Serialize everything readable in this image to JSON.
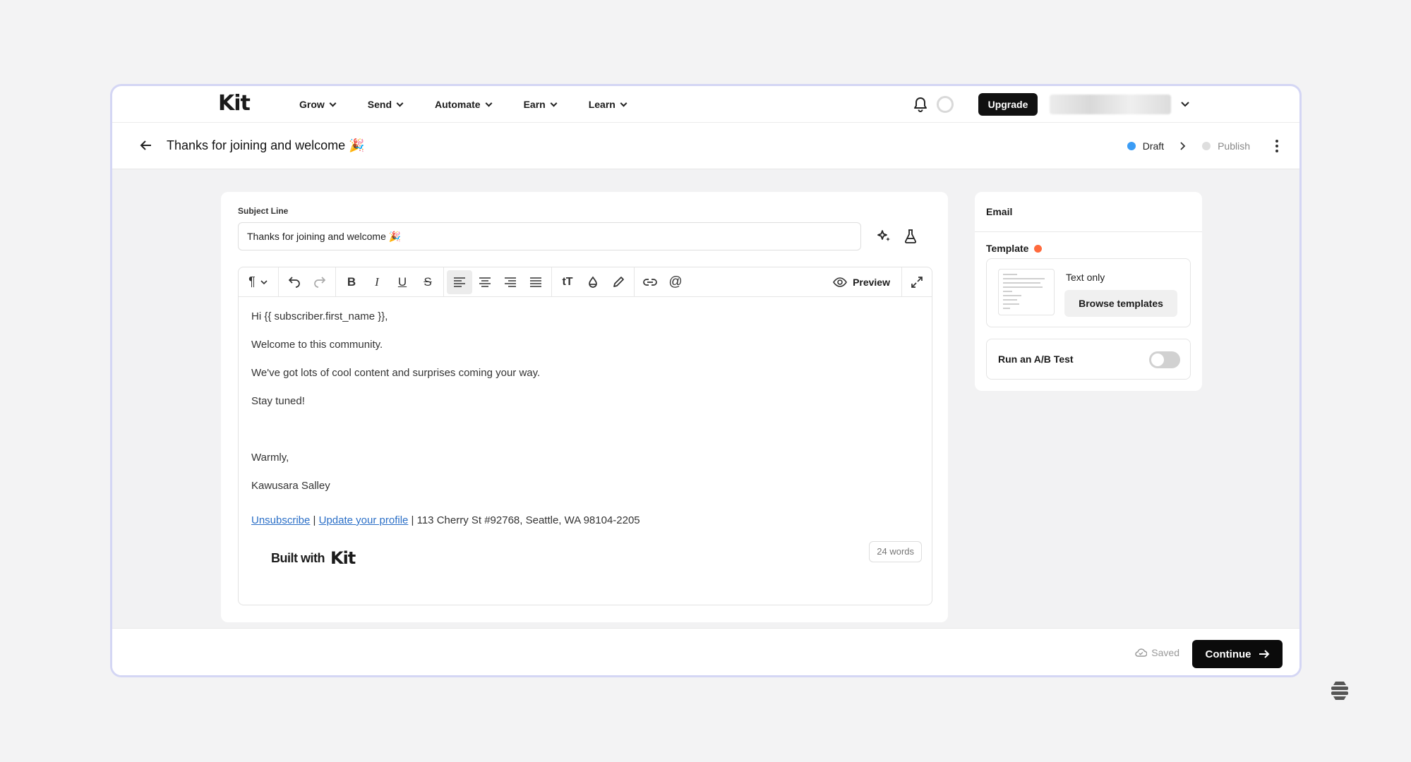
{
  "nav": {
    "logo": "Kit",
    "items": [
      {
        "label": "Grow"
      },
      {
        "label": "Send"
      },
      {
        "label": "Automate"
      },
      {
        "label": "Earn"
      },
      {
        "label": "Learn"
      }
    ],
    "upgrade_label": "Upgrade"
  },
  "header": {
    "title": "Thanks for joining and welcome 🎉",
    "steps": {
      "draft": "Draft",
      "publish": "Publish"
    }
  },
  "editor": {
    "subject_label": "Subject Line",
    "subject_value": "Thanks for joining and welcome 🎉",
    "preview_label": "Preview",
    "body": [
      "Hi {{ subscriber.first_name }},",
      "Welcome to this community.",
      "We've got lots of cool content and surprises coming your way.",
      "Stay tuned!",
      "",
      "Warmly,",
      "Kawusara Salley"
    ],
    "footer": {
      "unsubscribe": "Unsubscribe",
      "separator": "|",
      "update_profile": "Update your profile",
      "address": "| 113 Cherry St #92768, Seattle, WA 98104-2205"
    },
    "built_with": "Built with",
    "built_with_logo": "Kit",
    "word_count": "24 words"
  },
  "sidebar": {
    "title": "Email",
    "template_label": "Template",
    "template_name": "Text only",
    "browse_label": "Browse templates",
    "ab_label": "Run an A/B Test",
    "ab_enabled": false
  },
  "footer": {
    "saved_label": "Saved",
    "continue_label": "Continue"
  },
  "colors": {
    "accent": "#111111",
    "draft_dot": "#3b9cf5",
    "publish_dot": "#dedede",
    "template_dot": "#ff6a3d",
    "link": "#2b6fc7",
    "frame_border": "#d4d6f4"
  }
}
